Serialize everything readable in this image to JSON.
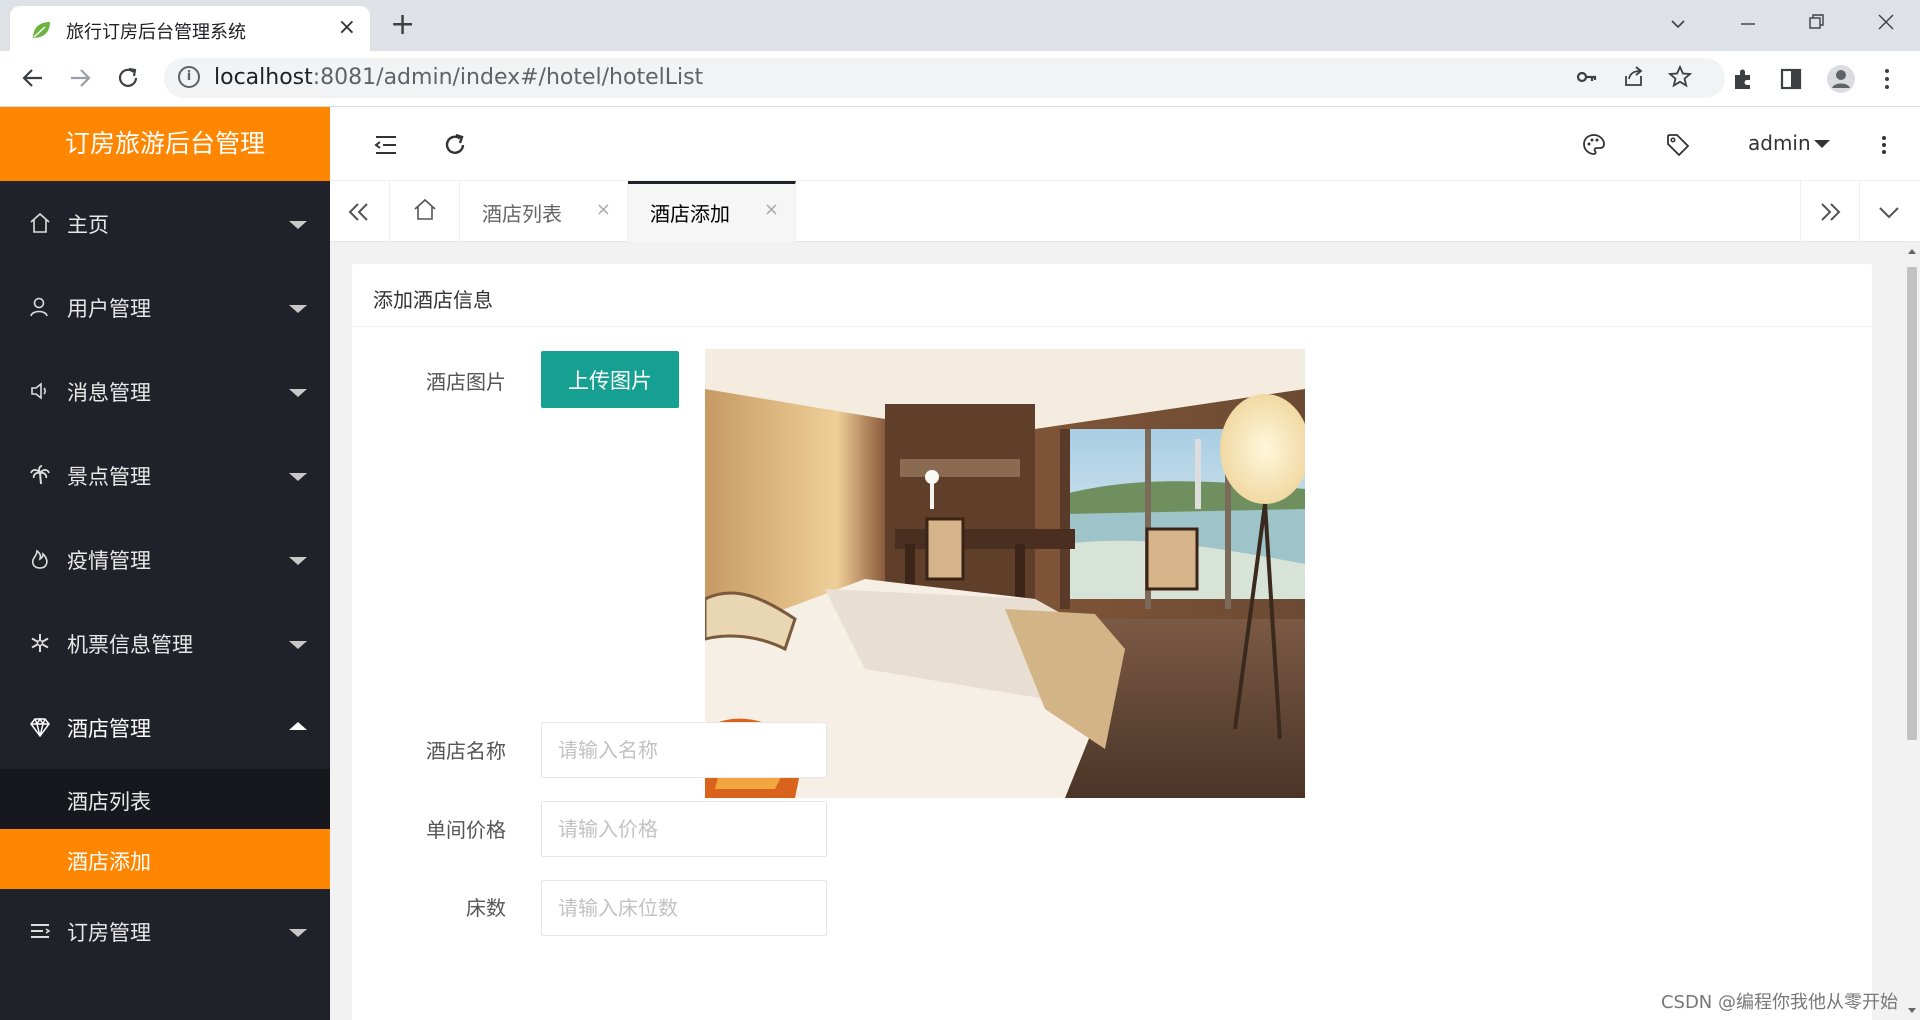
{
  "browser": {
    "tab_title": "旅行订房后台管理系统",
    "tab_close": "×",
    "new_tab": "+",
    "url_host": "localhost",
    "url_rest": ":8081/admin/index#/hotel/hotelList",
    "info_glyph": "i"
  },
  "sidebar": {
    "logo": "订房旅游后台管理",
    "items": [
      {
        "label": "主页",
        "icon": "home-icon"
      },
      {
        "label": "用户管理",
        "icon": "user-icon"
      },
      {
        "label": "消息管理",
        "icon": "speaker-icon"
      },
      {
        "label": "景点管理",
        "icon": "palm-icon"
      },
      {
        "label": "疫情管理",
        "icon": "fire-icon"
      },
      {
        "label": "机票信息管理",
        "icon": "snowflake-icon"
      },
      {
        "label": "酒店管理",
        "icon": "diamond-icon"
      },
      {
        "label": "订房管理",
        "icon": "list-icon"
      }
    ],
    "submenu": [
      {
        "label": "酒店列表"
      },
      {
        "label": "酒店添加"
      }
    ]
  },
  "header": {
    "user": "admin"
  },
  "page_tabs": [
    {
      "label": "酒店列表",
      "close": "×"
    },
    {
      "label": "酒店添加",
      "close": "×"
    }
  ],
  "form": {
    "title": "添加酒店信息",
    "image_label": "酒店图片",
    "upload_label": "上传图片",
    "name_label": "酒店名称",
    "name_placeholder": "请输入名称",
    "price_label": "单间价格",
    "price_placeholder": "请输入价格",
    "beds_label": "床数",
    "beds_placeholder": "请输入床位数"
  },
  "watermark": "CSDN @编程你我他从零开始",
  "colors": {
    "accent": "#ff8600",
    "sidebar_bg": "#20222a",
    "upload_button": "#16a092"
  }
}
